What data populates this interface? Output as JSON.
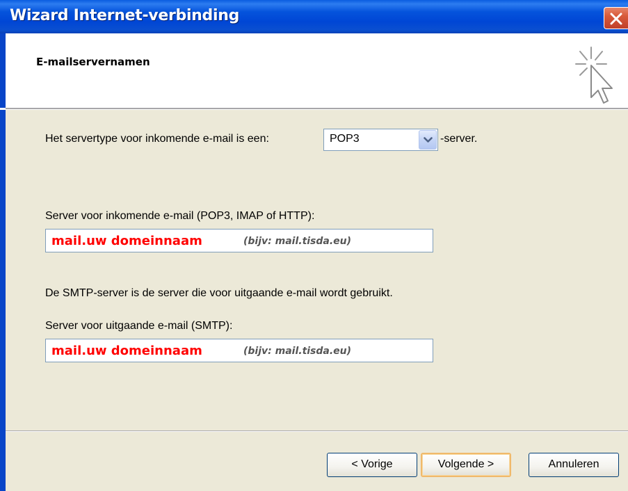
{
  "window": {
    "title": "Wizard Internet-verbinding",
    "accent": "#0845c8",
    "close_color": "#d85a3a"
  },
  "header": {
    "title": "E-mailservernamen",
    "icon": "wizard-cursor-icon"
  },
  "incoming_type": {
    "label_before": "Het servertype voor inkomende e-mail is een:",
    "selected": "POP3",
    "label_after": "-server."
  },
  "incoming_server": {
    "label": "Server voor inkomende e-mail (POP3, IMAP of HTTP):",
    "value": "mail.uw domeinnaam",
    "hint": "(bijv: mail.tisda.eu)"
  },
  "smtp_info": "De SMTP-server is de server die voor uitgaande e-mail wordt gebruikt.",
  "outgoing_server": {
    "label": "Server voor uitgaande e-mail (SMTP):",
    "value": "mail.uw domeinnaam",
    "hint": "(bijv: mail.tisda.eu)"
  },
  "buttons": {
    "back": "< Vorige",
    "next": "Volgende >",
    "cancel": "Annuleren"
  },
  "colors": {
    "value_text": "#ff0000",
    "dialog_bg": "#ece9d8"
  }
}
